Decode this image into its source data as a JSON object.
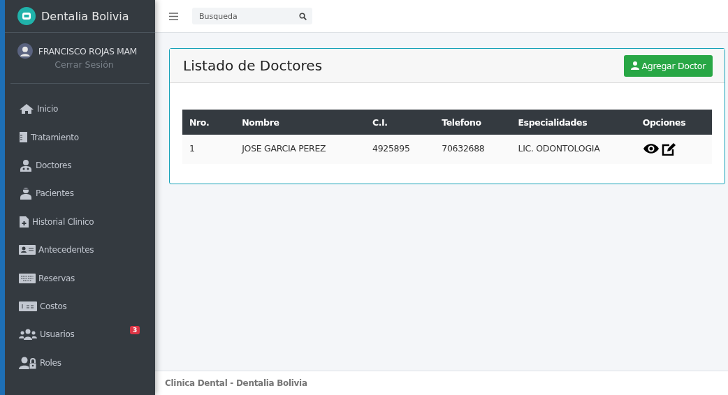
{
  "brand": {
    "name": "Dentalia Bolivia"
  },
  "user": {
    "name": "FRANCISCO ROJAS MAM",
    "logout": "Cerrar Sesión"
  },
  "menu": [
    {
      "label": "Inicio"
    },
    {
      "label": "Tratamiento"
    },
    {
      "label": "Doctores"
    },
    {
      "label": "Pacientes"
    },
    {
      "label": "Historial Clinico"
    },
    {
      "label": "Antecedentes"
    },
    {
      "label": "Reservas"
    },
    {
      "label": "Costos"
    },
    {
      "label": "Usuarios",
      "badge": "3"
    },
    {
      "label": "Roles"
    }
  ],
  "search": {
    "placeholder": "Busqueda"
  },
  "card": {
    "title": "Listado de Doctores",
    "add_button": "Agregar Doctor"
  },
  "table": {
    "columns": [
      "Nro.",
      "Nombre",
      "C.I.",
      "Telefono",
      "Especialidades",
      "Opciones"
    ],
    "rows": [
      {
        "cells": [
          "1",
          "JOSE GARCIA PEREZ",
          "4925895",
          "70632688",
          "LIC. ODONTOLOGIA"
        ]
      }
    ]
  },
  "footer": "Clinica Dental - Dentalia Bolivia"
}
